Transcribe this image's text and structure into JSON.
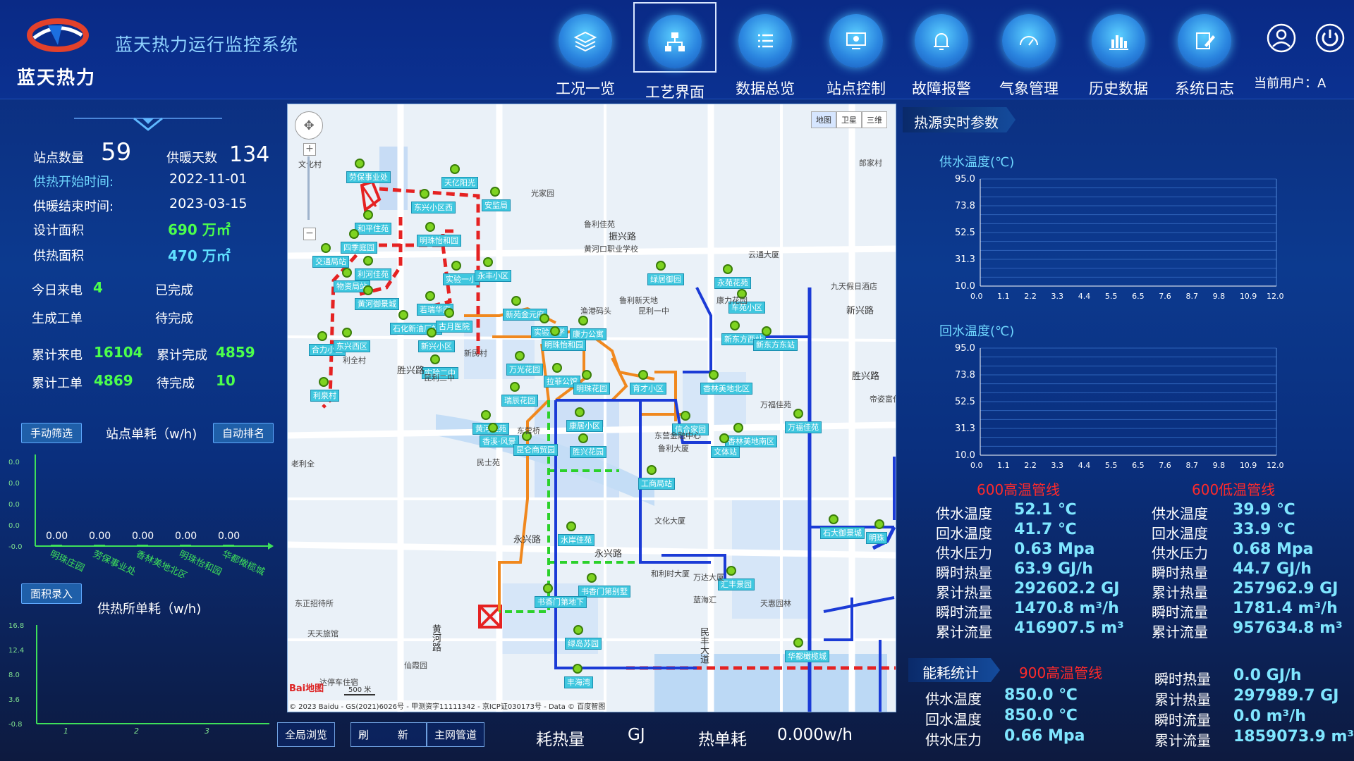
{
  "header": {
    "brand_name": "蓝天热力",
    "system_title": "蓝天热力运行监控系统",
    "nav": [
      {
        "label": "工况一览",
        "icon": "layers-icon"
      },
      {
        "label": "工艺界面",
        "icon": "org-chart-icon"
      },
      {
        "label": "数据总览",
        "icon": "list-icon"
      },
      {
        "label": "站点控制",
        "icon": "monitor-icon"
      },
      {
        "label": "故障报警",
        "icon": "bell-icon"
      },
      {
        "label": "气象管理",
        "icon": "gauge-icon"
      },
      {
        "label": "历史数据",
        "icon": "bar-chart-icon"
      },
      {
        "label": "系统日志",
        "icon": "edit-icon"
      }
    ],
    "active_nav": "工艺界面",
    "user_label": "当前用户：A"
  },
  "summary": {
    "station_count_label": "站点数量",
    "station_count": "59",
    "heating_days_label": "供暖天数",
    "heating_days": "134",
    "start_label": "供热开始时间:",
    "start_value": "2022-11-01",
    "end_label": "供暖结束时间:",
    "end_value": "2023-03-15",
    "design_area_label": "设计面积",
    "design_area": "690 万㎡",
    "heating_area_label": "供热面积",
    "heating_area": "470 万㎡",
    "today_calls_label": "今日来电",
    "today_calls": "4",
    "completed_label": "已完成",
    "work_order_label": "生成工单",
    "pending_label": "待完成",
    "total_calls_label": "累计来电",
    "total_calls": "16104",
    "total_completed_label": "累计完成",
    "total_completed": "4859",
    "total_orders_label": "累计工单",
    "total_orders": "4869",
    "total_pending_label": "待完成",
    "total_pending": "10"
  },
  "station_chart": {
    "filter_btn": "手动筛选",
    "title": "站点单耗（w/h)",
    "sort_btn": "自动排名",
    "chart_data": {
      "type": "bar",
      "categories": [
        "明珠庄园",
        "劳保事业处",
        "香林美地北区",
        "明珠怡和园",
        "华都橄榄城"
      ],
      "values": [
        0,
        0,
        0,
        0,
        0
      ],
      "value_labels": [
        "0.00",
        "0.00",
        "0.00",
        "0.00",
        "0.00"
      ],
      "y_ticks": [
        "0.0",
        "0.0",
        "0.0",
        "0.0",
        "-0.0"
      ]
    }
  },
  "area_chart": {
    "entry_btn": "面积录入",
    "title": "供热所单耗（w/h)",
    "chart_data": {
      "type": "line",
      "x_ticks": [
        "1",
        "2",
        "3"
      ],
      "y_ticks": [
        "16.8",
        "12.4",
        "8.0",
        "3.6",
        "-0.8"
      ],
      "ylim": [
        -0.8,
        16.8
      ],
      "series": []
    }
  },
  "map": {
    "map_type_btns": [
      "地图",
      "卫星",
      "三维"
    ],
    "copyright": "© 2023 Baidu - GS(2021)6026号 - 甲测资字11111342 - 京ICP证030173号 - Data © 百度智图",
    "scale": "500 米",
    "baidu": "Bai地图",
    "stations": [
      "劳保事业处",
      "天亿阳光",
      "安监局",
      "东兴小区西",
      "和平住苑",
      "明珠怡和园",
      "四季庭园",
      "交通局站",
      "利河佳苑",
      "实验一小",
      "永丰小区",
      "物资局站",
      "黄河御景城",
      "若瑞华府",
      "新苑金元府",
      "绿居御园",
      "永苑花苑",
      "车苑小区",
      "石化新油厂站",
      "古月医院",
      "合力小区",
      "东兴西区",
      "新兴小区",
      "实验中学",
      "康力公寓",
      "明珠怡和园",
      "新东方西站",
      "新东方东站",
      "实验二中",
      "万光花园",
      "拉菲公馆",
      "明珠花园",
      "育才小区",
      "香林美地北区",
      "利泉村",
      "瑞辰花园",
      "黄河佳苑",
      "康居小区",
      "信合家园",
      "香林美地南区",
      "万福佳苑",
      "香溪·风景",
      "胜兴花园",
      "文体站",
      "昆仑商贸园",
      "工商局站",
      "水岸佳苑",
      "石大御景城",
      "明珠",
      "书香门第别墅",
      "书香门第地下",
      "汇丰景园",
      "绿岛苏园",
      "华都橄榄城",
      "丰海湾"
    ],
    "roads": [
      "振兴路",
      "新兴路",
      "胜兴路",
      "胜兴路",
      "黄河路",
      "民丰大道",
      "永兴路",
      "永兴路"
    ],
    "places": [
      "文化村",
      "光家园",
      "鲁利佳苑",
      "黄河口职业学校",
      "云通大厦",
      "郎家村",
      "九天假日酒店",
      "康力花园",
      "鲁利新天地",
      "渔港码头",
      "昆利一中",
      "利全村",
      "新民村",
      "民士苑",
      "东营桥",
      "昆利二中",
      "万福佳苑",
      "帝姿富仕城",
      "东营金融中心",
      "鲁利大厦",
      "文化大厦",
      "和利时大厦",
      "万达大厦",
      "蓝海汇",
      "天惠园林",
      "东正招待所",
      "天天旅馆",
      "仙霞园",
      "达停车住宿",
      "老利全"
    ]
  },
  "right": {
    "heat_source_title": "热源实时参数",
    "supply_chart": {
      "title": "供水温度(℃)",
      "chart_data": {
        "type": "line",
        "y_ticks": [
          "95.0",
          "73.8",
          "52.5",
          "31.3",
          "10.0"
        ],
        "x_ticks": [
          "0.0",
          "1.1",
          "2.2",
          "3.3",
          "4.4",
          "5.5",
          "6.5",
          "7.6",
          "8.7",
          "9.8",
          "10.9",
          "12.0"
        ],
        "ylim": [
          10,
          95
        ],
        "xlim": [
          0,
          12
        ],
        "series": []
      }
    },
    "return_chart": {
      "title": "回水温度(℃)",
      "chart_data": {
        "type": "line",
        "y_ticks": [
          "95.0",
          "73.8",
          "52.5",
          "31.3",
          "10.0"
        ],
        "x_ticks": [
          "0.0",
          "1.1",
          "2.2",
          "3.3",
          "4.4",
          "5.5",
          "6.5",
          "7.6",
          "8.7",
          "9.8",
          "10.9",
          "12.0"
        ],
        "ylim": [
          10,
          95
        ],
        "xlim": [
          0,
          12
        ],
        "series": []
      }
    },
    "pipe600h": {
      "title": "600高温管线",
      "rows": [
        {
          "label": "供水温度",
          "value": "52.1 ℃"
        },
        {
          "label": "回水温度",
          "value": "41.7 ℃"
        },
        {
          "label": "供水压力",
          "value": "0.63 Mpa"
        },
        {
          "label": "瞬时热量",
          "value": "63.9 GJ/h"
        },
        {
          "label": "累计热量",
          "value": "292602.2 GJ"
        },
        {
          "label": "瞬时流量",
          "value": "1470.8 m³/h"
        },
        {
          "label": "累计流量",
          "value": "416907.5 m³"
        }
      ]
    },
    "pipe600l": {
      "title": "600低温管线",
      "rows": [
        {
          "label": "供水温度",
          "value": "39.9 ℃"
        },
        {
          "label": "回水温度",
          "value": "33.9 ℃"
        },
        {
          "label": "供水压力",
          "value": "0.68 Mpa"
        },
        {
          "label": "瞬时热量",
          "value": "44.7 GJ/h"
        },
        {
          "label": "累计热量",
          "value": "257962.9 GJ"
        },
        {
          "label": "瞬时流量",
          "value": "1781.4 m³/h"
        },
        {
          "label": "累计流量",
          "value": "957634.8 m³"
        }
      ]
    },
    "energy_title": "能耗统计",
    "pipe900": {
      "title": "900高温管线",
      "rows_left": [
        {
          "label": "供水温度",
          "value": "850.0 ℃"
        },
        {
          "label": "回水温度",
          "value": "850.0 ℃"
        },
        {
          "label": "供水压力",
          "value": "0.66 Mpa"
        }
      ],
      "rows_right": [
        {
          "label": "瞬时热量",
          "value": "0.0 GJ/h"
        },
        {
          "label": "累计热量",
          "value": "297989.7 GJ"
        },
        {
          "label": "瞬时流量",
          "value": "0.0 m³/h"
        },
        {
          "label": "累计流量",
          "value": "1859073.9 m³"
        }
      ]
    }
  },
  "bottom": {
    "btn_global": "全局浏览",
    "btn_refresh_a": "刷",
    "btn_refresh_b": "新",
    "btn_pipe": "主网管道",
    "heat_label": "耗热量",
    "heat_unit": "GJ",
    "unit_label": "热单耗",
    "unit_value": "0.000w/h"
  },
  "colors": {
    "accent": "#5fe0ff",
    "green": "#4cff4c",
    "red": "#ff2a2a",
    "map_tag": "#3fc7df"
  }
}
